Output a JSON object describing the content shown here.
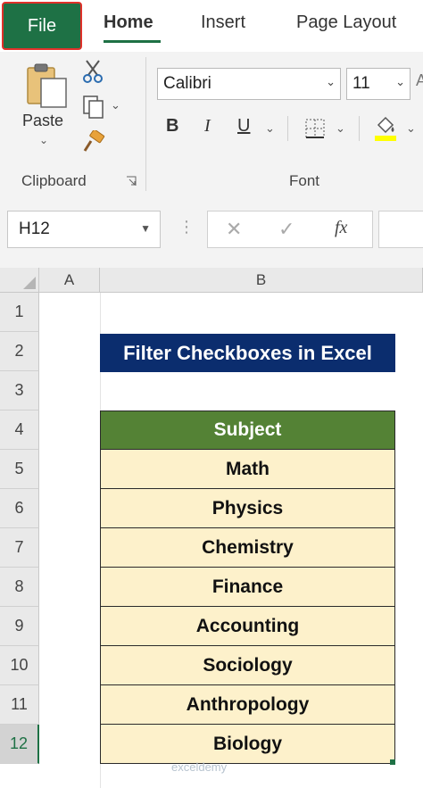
{
  "tabs": {
    "file": "File",
    "home": "Home",
    "insert": "Insert",
    "page_layout": "Page Layout"
  },
  "ribbon": {
    "clipboard": {
      "paste_label": "Paste",
      "group_label": "Clipboard"
    },
    "font": {
      "font_name": "Calibri",
      "font_size": "11",
      "bold": "B",
      "italic": "I",
      "underline": "U",
      "group_label": "Font"
    }
  },
  "formula_bar": {
    "name_box": "H12",
    "cancel_glyph": "✕",
    "enter_glyph": "✓",
    "fx_label": "fx"
  },
  "grid": {
    "columns": [
      "A",
      "B"
    ],
    "rows": [
      "1",
      "2",
      "3",
      "4",
      "5",
      "6",
      "7",
      "8",
      "9",
      "10",
      "11",
      "12"
    ],
    "active_row": "12",
    "title": "Filter Checkboxes in Excel",
    "table_header": "Subject",
    "subjects": [
      "Math",
      "Physics",
      "Chemistry",
      "Finance",
      "Accounting",
      "Sociology",
      "Anthropology",
      "Biology"
    ]
  },
  "watermark": "exceldemy",
  "colors": {
    "excel_green": "#1e7145",
    "title_bg": "#0b2d6e",
    "table_header_bg": "#548235",
    "table_cell_bg": "#fdf1cb",
    "file_border": "#e0312a"
  }
}
